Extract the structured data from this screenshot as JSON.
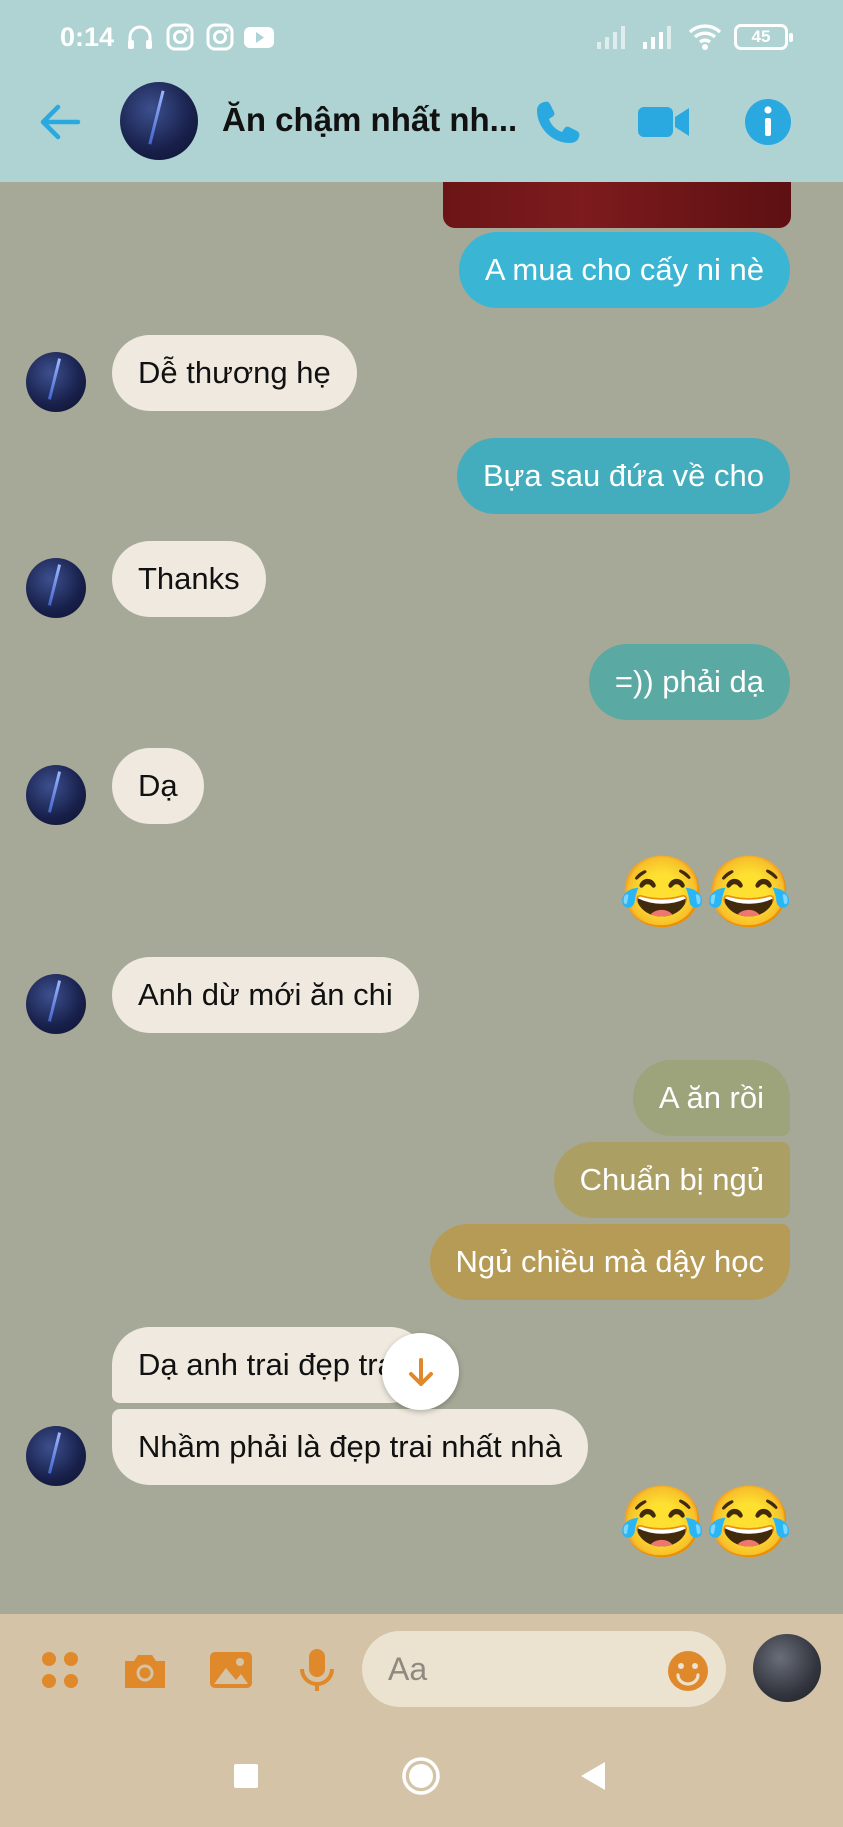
{
  "status_bar": {
    "time": "0:14",
    "battery": "45",
    "icons": [
      "headphones-icon",
      "instagram-icon",
      "instagram-icon",
      "youtube-icon",
      "signal-icon",
      "signal-icon",
      "wifi-icon",
      "battery-icon"
    ]
  },
  "header": {
    "title": "Ăn chậm nhất nh...",
    "icons": [
      "back-arrow-icon",
      "phone-icon",
      "video-call-icon",
      "info-icon"
    ],
    "accent_color": "#2aa9e0"
  },
  "messages": [
    {
      "side": "out",
      "text": "A mua cho cấy ni nè",
      "color": "#3ab5d4"
    },
    {
      "side": "in",
      "text": "Dễ thương hẹ"
    },
    {
      "side": "out",
      "text": "Bựa sau đứa về cho",
      "color": "#43adbe"
    },
    {
      "side": "in",
      "text": "Thanks"
    },
    {
      "side": "out",
      "text": "=)) phải dạ",
      "color": "#5aa9a3"
    },
    {
      "side": "in",
      "text": "Dạ"
    },
    {
      "side": "out",
      "emoji": "😂😂"
    },
    {
      "side": "in",
      "text": "Anh dừ mới ăn chi"
    },
    {
      "side": "out",
      "text": "A ăn rồi",
      "color": "#9da37a"
    },
    {
      "side": "out",
      "text": "Chuẩn bị ngủ",
      "color": "#ab9f64"
    },
    {
      "side": "out",
      "text": "Ngủ chiều mà dậy học",
      "color": "#b59b55"
    },
    {
      "side": "in",
      "text": "Dạ anh trai đẹp trai"
    },
    {
      "side": "in",
      "text": "Nhầm phải là đẹp trai nhất nhà"
    },
    {
      "side": "out",
      "emoji": "😂😂"
    }
  ],
  "composer": {
    "placeholder": "Aa",
    "icons": [
      "apps-grid-icon",
      "camera-icon",
      "gallery-icon",
      "microphone-icon",
      "emoji-icon"
    ],
    "accent_color": "#e0892a"
  },
  "nav_bar": {
    "icons": [
      "recent-apps-icon",
      "home-icon",
      "back-icon"
    ]
  }
}
